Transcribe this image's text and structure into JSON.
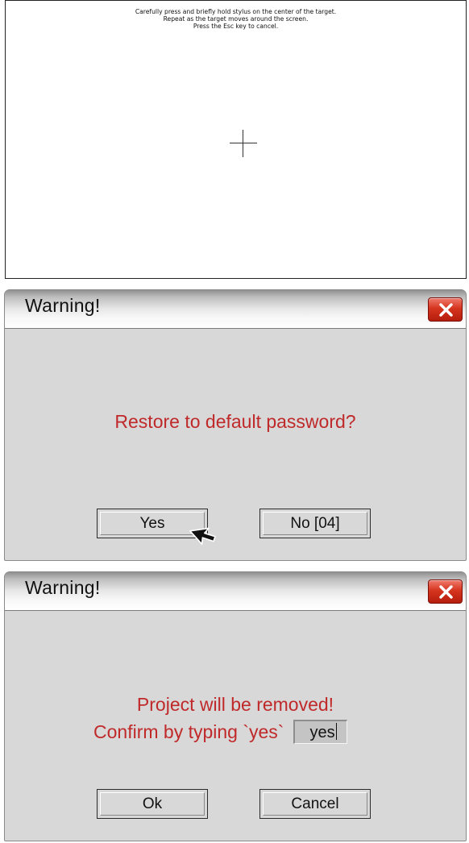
{
  "calibration": {
    "instructions": [
      "Carefully press and briefly hold stylus on the center of the target.",
      "Repeat as the target moves around the screen.",
      "Press the Esc key to cancel."
    ]
  },
  "dialog_restore": {
    "title": "Warning!",
    "message": "Restore to default password?",
    "yes_label": "Yes",
    "no_label": "No [04]"
  },
  "dialog_remove": {
    "title": "Warning!",
    "message": "Project will be removed!",
    "confirm_label": "Confirm by typing `yes`",
    "input_value": "yes",
    "ok_label": "Ok",
    "cancel_label": "Cancel"
  },
  "colors": {
    "message_text": "#c0292a",
    "close_button": "#d5351f",
    "dialog_background": "#d8d8d8"
  },
  "icons": {
    "close": "close-icon",
    "crosshair": "crosshair-target-icon",
    "cursor": "mouse-pointer-icon"
  }
}
